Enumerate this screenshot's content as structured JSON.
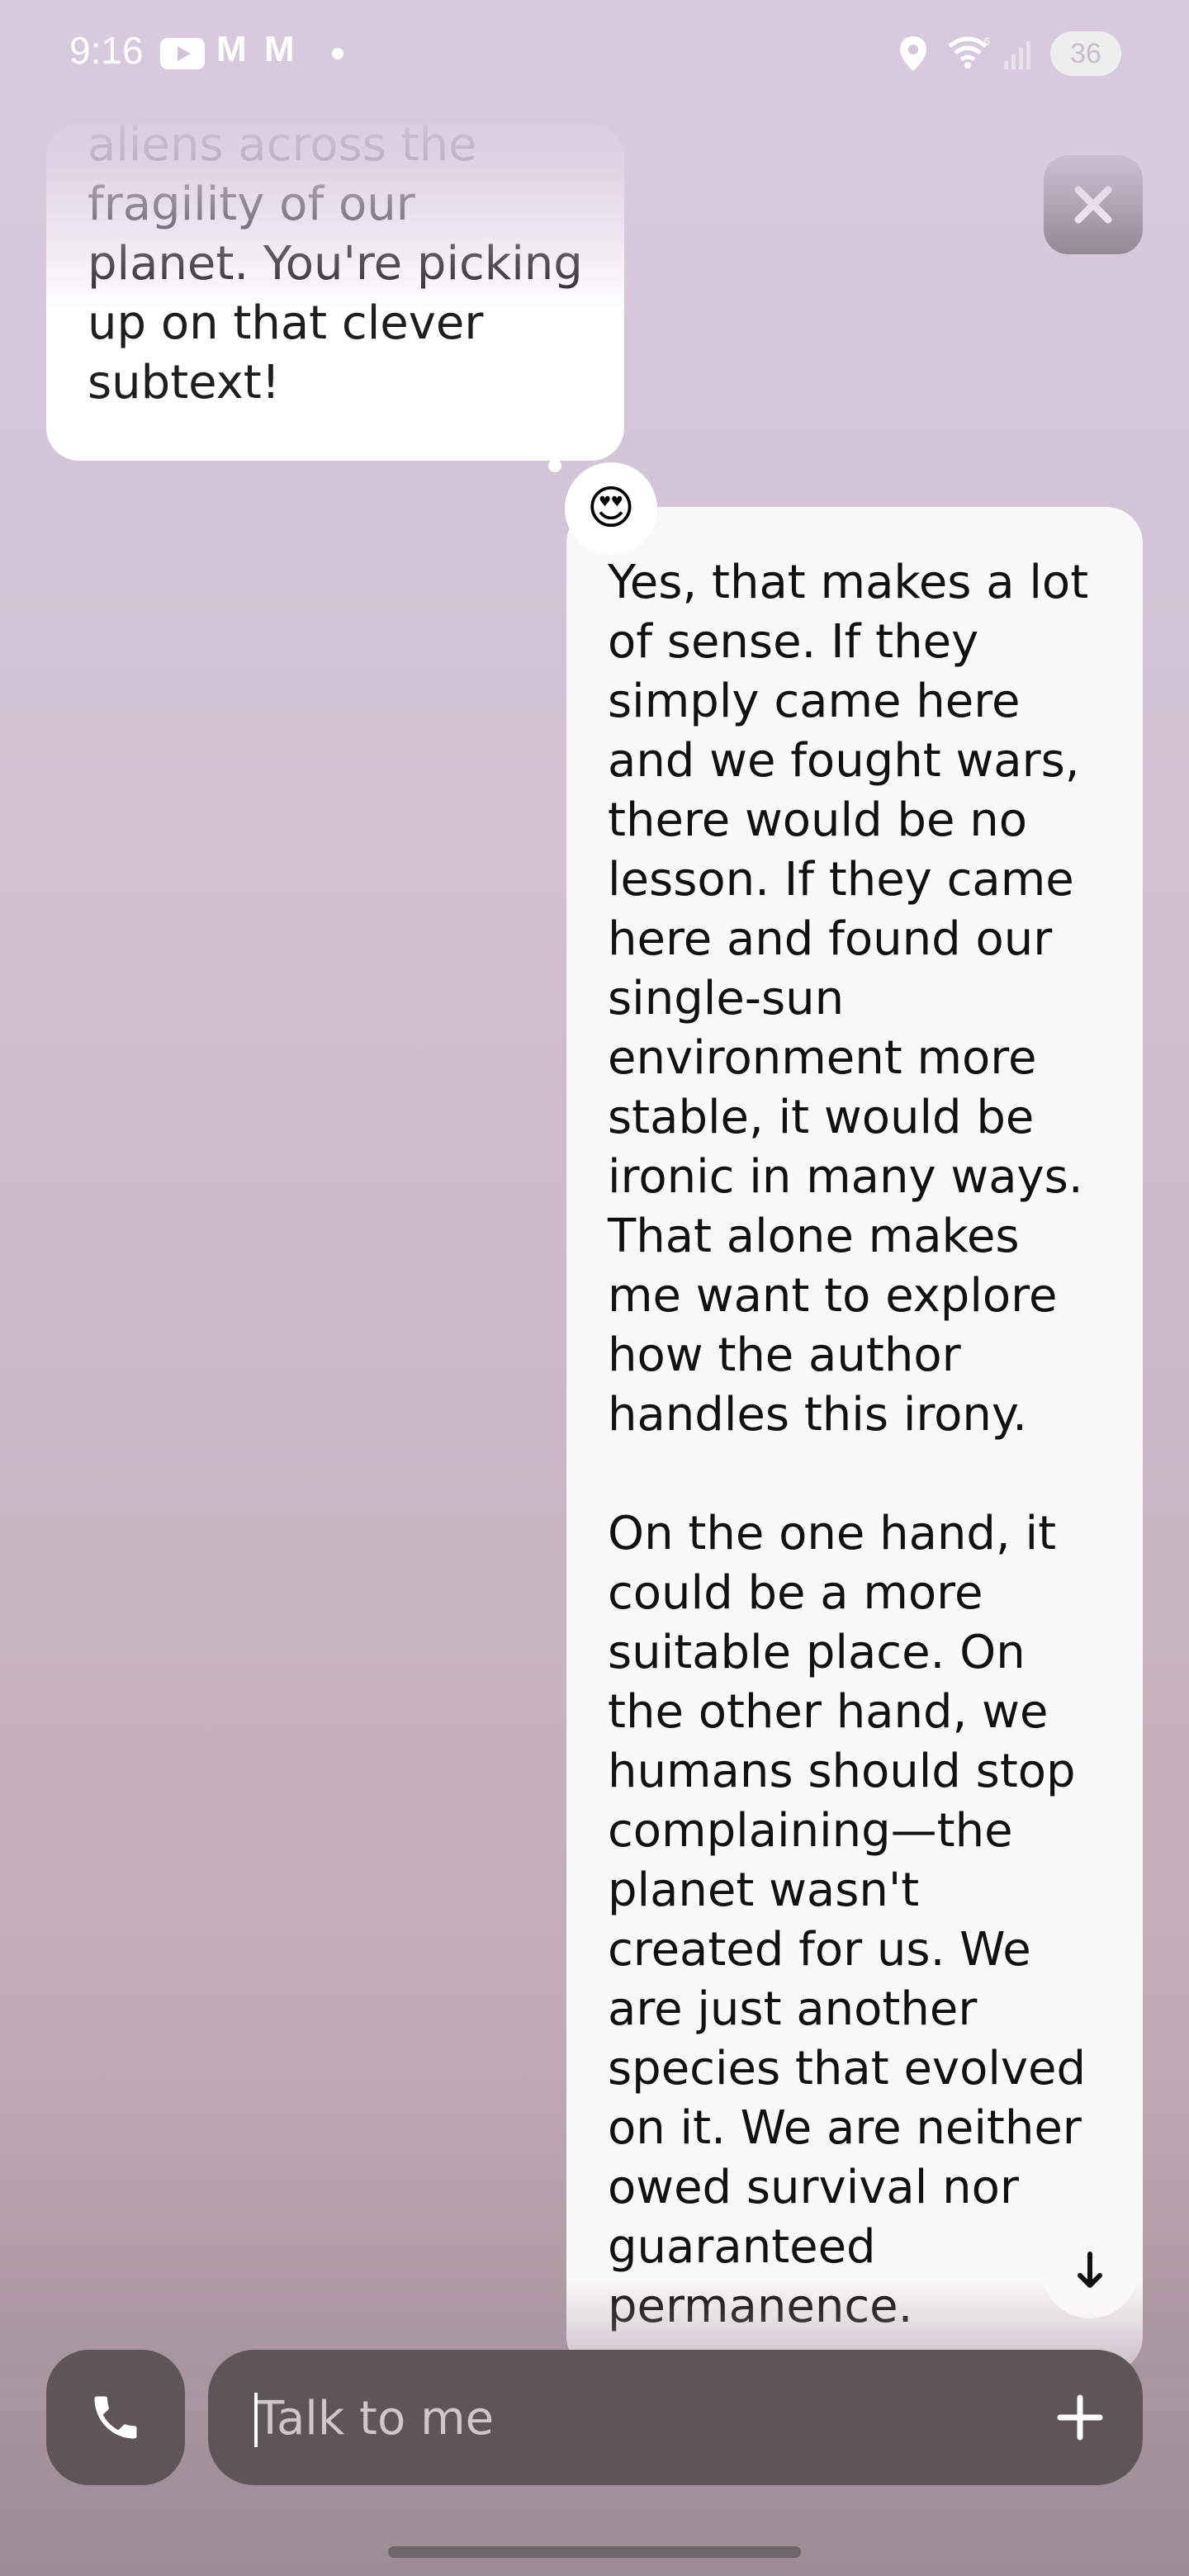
{
  "status_bar": {
    "time": "9:16",
    "battery": "36",
    "gmail_1": "M",
    "gmail_2": "M"
  },
  "chat": {
    "ai_message": "aliens across the fragility of our planet. You're picking up on that clever subtext!",
    "reaction_emoji": "😍",
    "user_message_p1": "Yes, that makes a lot of sense. If they simply came here and we fought wars, there would be no lesson. If they came here and found our single-sun environment more stable, it would be ironic in many ways. That alone makes me want to explore how the author handles this irony.",
    "user_message_p2": "On the one hand, it could be a more suitable place. On the other hand, we humans should stop complaining—the planet wasn't created for us. We are just another species that evolved on it. We are neither owed survival nor guaranteed permanence."
  },
  "composer": {
    "placeholder": "Talk to me"
  },
  "icons": {
    "close": "close-icon",
    "phone": "phone-icon",
    "plus": "plus-icon",
    "scroll_down": "arrow-down-icon"
  },
  "colors": {
    "bubble": "#ffffff",
    "bar": "#5e5558"
  }
}
